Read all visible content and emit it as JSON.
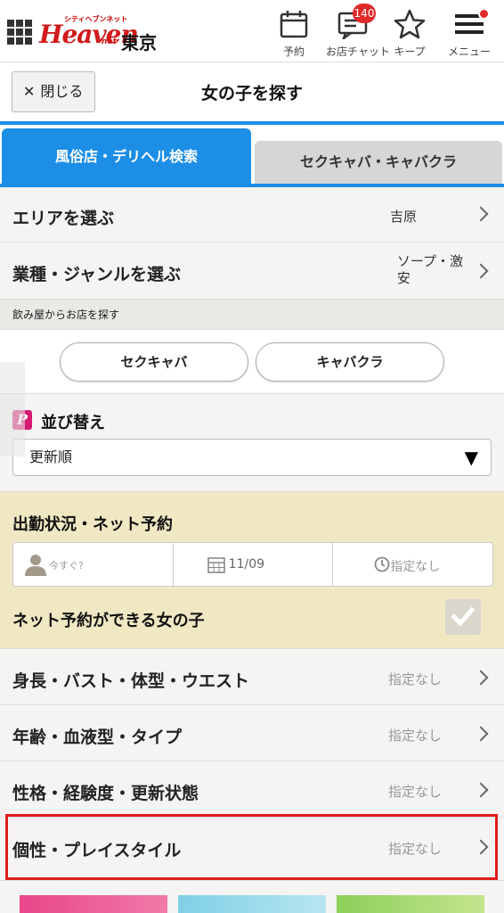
{
  "header": {
    "logo_small": "シティヘブンネット",
    "logo_main": "Heaven",
    "logo_net": "net",
    "city": "東京",
    "icons": [
      {
        "name": "calendar-icon",
        "label": "予約"
      },
      {
        "name": "chat-icon",
        "label": "お店チャット",
        "badge": "140"
      },
      {
        "name": "star-icon",
        "label": "キープ"
      },
      {
        "name": "hamburger-icon",
        "label": "メニュー"
      }
    ]
  },
  "titlebar": {
    "close_label": "閉じる",
    "close_glyph": "✕",
    "title": "女の子を探す"
  },
  "tabs": [
    {
      "label": "風俗店・デリヘル検索",
      "active": true
    },
    {
      "label": "セクキャバ・キャバクラ",
      "active": false
    }
  ],
  "filters": {
    "area": {
      "label": "エリアを選ぶ",
      "value": "吉原"
    },
    "genre": {
      "label": "業種・ジャンルを選ぶ",
      "value_line1": "ソープ・激",
      "value_line2": "安"
    }
  },
  "bar_section": {
    "heading": "飲み屋からお店を探す",
    "buttons": [
      "セクキャバ",
      "キャバクラ"
    ]
  },
  "sort": {
    "icon_letter": "P",
    "title": "並び替え",
    "selected": "更新順",
    "arrow": "▼"
  },
  "attendance": {
    "title": "出勤状況・ネット予約",
    "fields": [
      {
        "icon": "person-icon",
        "text": "今すぐ?"
      },
      {
        "icon": "calendar-small-icon",
        "text": "11/09"
      },
      {
        "icon": "clock-icon",
        "text": "指定なし"
      }
    ],
    "net_reservation_label": "ネット予約ができる女の子",
    "net_reservation_checked": false
  },
  "criteria": [
    {
      "label": "身長・バスト・体型・ウエスト",
      "value": "指定なし"
    },
    {
      "label": "年齢・血液型・タイプ",
      "value": "指定なし"
    },
    {
      "label": "性格・経験度・更新状態",
      "value": "指定なし"
    },
    {
      "label": "個性・プレイスタイル",
      "value": "指定なし"
    }
  ],
  "colors": {
    "accent": "#1c8ee6",
    "highlight": "#e01c1c",
    "attendance_bg": "#efe8c3",
    "badge": "#e02b2b"
  }
}
